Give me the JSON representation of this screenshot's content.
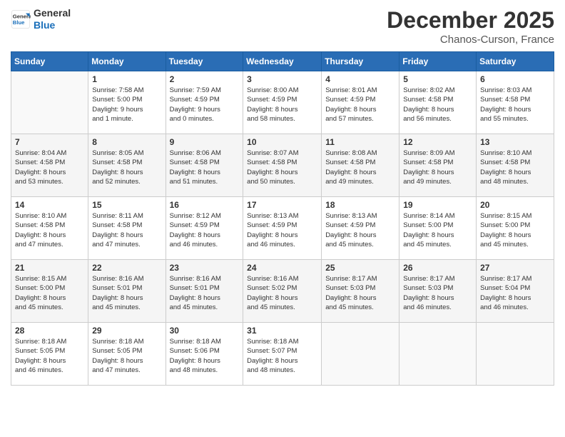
{
  "header": {
    "logo_line1": "General",
    "logo_line2": "Blue",
    "month": "December 2025",
    "location": "Chanos-Curson, France"
  },
  "weekdays": [
    "Sunday",
    "Monday",
    "Tuesday",
    "Wednesday",
    "Thursday",
    "Friday",
    "Saturday"
  ],
  "weeks": [
    [
      {
        "day": "",
        "info": ""
      },
      {
        "day": "1",
        "info": "Sunrise: 7:58 AM\nSunset: 5:00 PM\nDaylight: 9 hours\nand 1 minute."
      },
      {
        "day": "2",
        "info": "Sunrise: 7:59 AM\nSunset: 4:59 PM\nDaylight: 9 hours\nand 0 minutes."
      },
      {
        "day": "3",
        "info": "Sunrise: 8:00 AM\nSunset: 4:59 PM\nDaylight: 8 hours\nand 58 minutes."
      },
      {
        "day": "4",
        "info": "Sunrise: 8:01 AM\nSunset: 4:59 PM\nDaylight: 8 hours\nand 57 minutes."
      },
      {
        "day": "5",
        "info": "Sunrise: 8:02 AM\nSunset: 4:58 PM\nDaylight: 8 hours\nand 56 minutes."
      },
      {
        "day": "6",
        "info": "Sunrise: 8:03 AM\nSunset: 4:58 PM\nDaylight: 8 hours\nand 55 minutes."
      }
    ],
    [
      {
        "day": "7",
        "info": "Sunrise: 8:04 AM\nSunset: 4:58 PM\nDaylight: 8 hours\nand 53 minutes."
      },
      {
        "day": "8",
        "info": "Sunrise: 8:05 AM\nSunset: 4:58 PM\nDaylight: 8 hours\nand 52 minutes."
      },
      {
        "day": "9",
        "info": "Sunrise: 8:06 AM\nSunset: 4:58 PM\nDaylight: 8 hours\nand 51 minutes."
      },
      {
        "day": "10",
        "info": "Sunrise: 8:07 AM\nSunset: 4:58 PM\nDaylight: 8 hours\nand 50 minutes."
      },
      {
        "day": "11",
        "info": "Sunrise: 8:08 AM\nSunset: 4:58 PM\nDaylight: 8 hours\nand 49 minutes."
      },
      {
        "day": "12",
        "info": "Sunrise: 8:09 AM\nSunset: 4:58 PM\nDaylight: 8 hours\nand 49 minutes."
      },
      {
        "day": "13",
        "info": "Sunrise: 8:10 AM\nSunset: 4:58 PM\nDaylight: 8 hours\nand 48 minutes."
      }
    ],
    [
      {
        "day": "14",
        "info": "Sunrise: 8:10 AM\nSunset: 4:58 PM\nDaylight: 8 hours\nand 47 minutes."
      },
      {
        "day": "15",
        "info": "Sunrise: 8:11 AM\nSunset: 4:58 PM\nDaylight: 8 hours\nand 47 minutes."
      },
      {
        "day": "16",
        "info": "Sunrise: 8:12 AM\nSunset: 4:59 PM\nDaylight: 8 hours\nand 46 minutes."
      },
      {
        "day": "17",
        "info": "Sunrise: 8:13 AM\nSunset: 4:59 PM\nDaylight: 8 hours\nand 46 minutes."
      },
      {
        "day": "18",
        "info": "Sunrise: 8:13 AM\nSunset: 4:59 PM\nDaylight: 8 hours\nand 45 minutes."
      },
      {
        "day": "19",
        "info": "Sunrise: 8:14 AM\nSunset: 5:00 PM\nDaylight: 8 hours\nand 45 minutes."
      },
      {
        "day": "20",
        "info": "Sunrise: 8:15 AM\nSunset: 5:00 PM\nDaylight: 8 hours\nand 45 minutes."
      }
    ],
    [
      {
        "day": "21",
        "info": "Sunrise: 8:15 AM\nSunset: 5:00 PM\nDaylight: 8 hours\nand 45 minutes."
      },
      {
        "day": "22",
        "info": "Sunrise: 8:16 AM\nSunset: 5:01 PM\nDaylight: 8 hours\nand 45 minutes."
      },
      {
        "day": "23",
        "info": "Sunrise: 8:16 AM\nSunset: 5:01 PM\nDaylight: 8 hours\nand 45 minutes."
      },
      {
        "day": "24",
        "info": "Sunrise: 8:16 AM\nSunset: 5:02 PM\nDaylight: 8 hours\nand 45 minutes."
      },
      {
        "day": "25",
        "info": "Sunrise: 8:17 AM\nSunset: 5:03 PM\nDaylight: 8 hours\nand 45 minutes."
      },
      {
        "day": "26",
        "info": "Sunrise: 8:17 AM\nSunset: 5:03 PM\nDaylight: 8 hours\nand 46 minutes."
      },
      {
        "day": "27",
        "info": "Sunrise: 8:17 AM\nSunset: 5:04 PM\nDaylight: 8 hours\nand 46 minutes."
      }
    ],
    [
      {
        "day": "28",
        "info": "Sunrise: 8:18 AM\nSunset: 5:05 PM\nDaylight: 8 hours\nand 46 minutes."
      },
      {
        "day": "29",
        "info": "Sunrise: 8:18 AM\nSunset: 5:05 PM\nDaylight: 8 hours\nand 47 minutes."
      },
      {
        "day": "30",
        "info": "Sunrise: 8:18 AM\nSunset: 5:06 PM\nDaylight: 8 hours\nand 48 minutes."
      },
      {
        "day": "31",
        "info": "Sunrise: 8:18 AM\nSunset: 5:07 PM\nDaylight: 8 hours\nand 48 minutes."
      },
      {
        "day": "",
        "info": ""
      },
      {
        "day": "",
        "info": ""
      },
      {
        "day": "",
        "info": ""
      }
    ]
  ]
}
